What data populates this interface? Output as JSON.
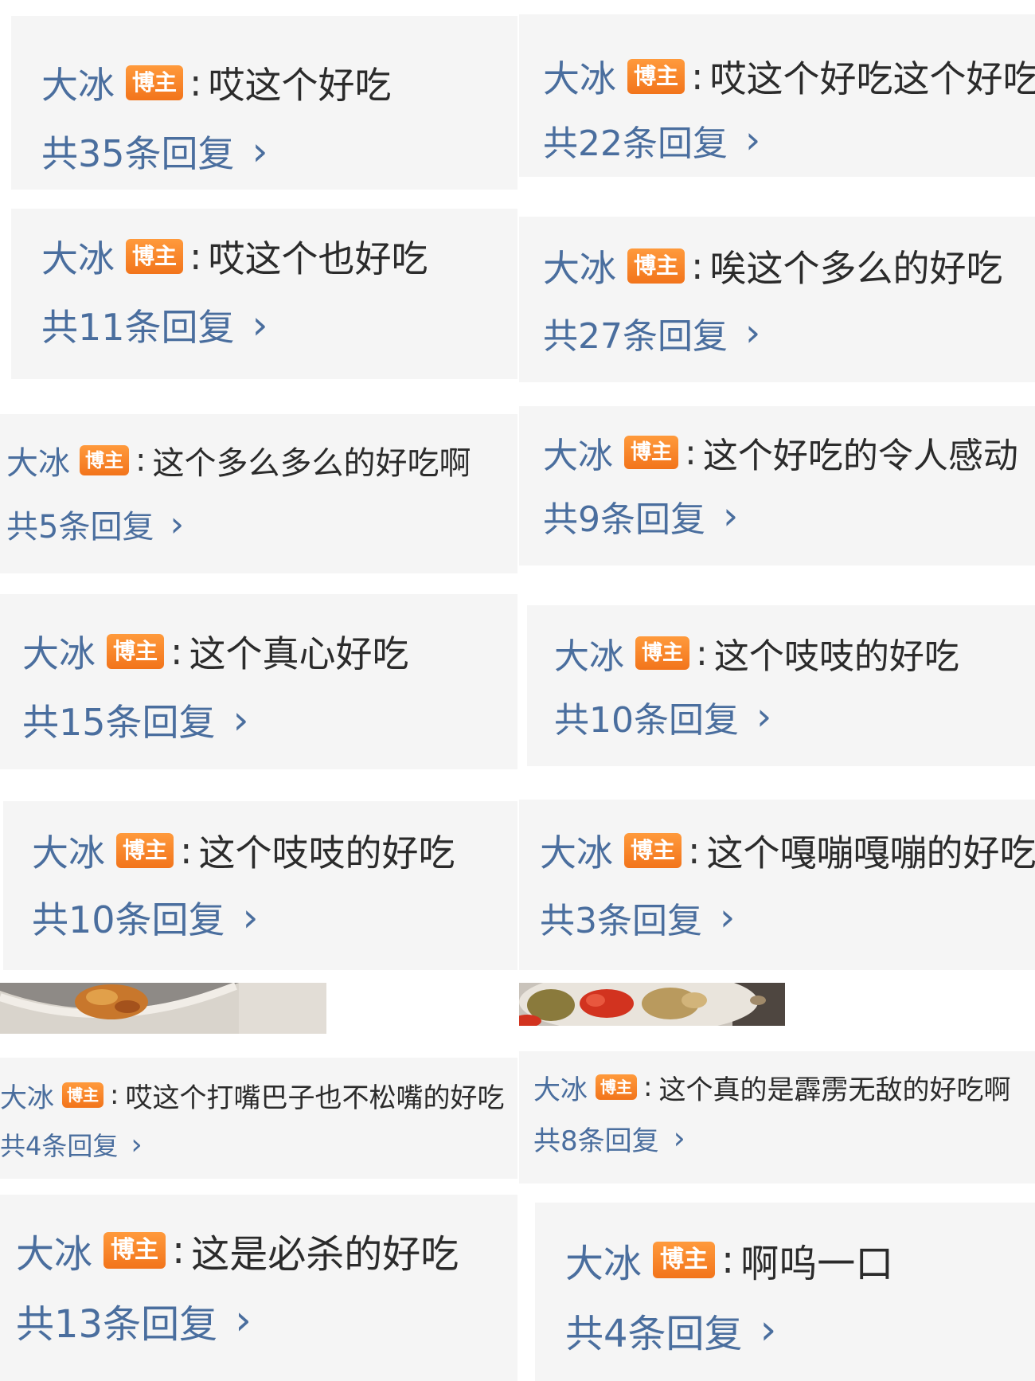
{
  "comments": [
    {
      "author": "大冰",
      "badge": "博主",
      "sep": ":",
      "text": "哎这个好吃",
      "replies": "共35条回复",
      "chevron": "›"
    },
    {
      "author": "大冰",
      "badge": "博主",
      "sep": ":",
      "text": "哎这个好吃这个好吃",
      "replies": "共22条回复",
      "chevron": "›"
    },
    {
      "author": "大冰",
      "badge": "博主",
      "sep": ":",
      "text": "哎这个也好吃",
      "replies": "共11条回复",
      "chevron": "›"
    },
    {
      "author": "大冰",
      "badge": "博主",
      "sep": ":",
      "text": "唉这个多么的好吃",
      "replies": "共27条回复",
      "chevron": "›"
    },
    {
      "author": "大冰",
      "badge": "博主",
      "sep": ":",
      "text": "这个多么多么的好吃啊",
      "replies": "共5条回复",
      "chevron": "›"
    },
    {
      "author": "大冰",
      "badge": "博主",
      "sep": ":",
      "text": "这个好吃的令人感动",
      "replies": "共9条回复",
      "chevron": "›"
    },
    {
      "author": "大冰",
      "badge": "博主",
      "sep": ":",
      "text": "这个真心好吃",
      "replies": "共15条回复",
      "chevron": "›"
    },
    {
      "author": "大冰",
      "badge": "博主",
      "sep": ":",
      "text": "这个吱吱的好吃",
      "replies": "共10条回复",
      "chevron": "›"
    },
    {
      "author": "大冰",
      "badge": "博主",
      "sep": ":",
      "text": "这个吱吱的好吃",
      "replies": "共10条回复",
      "chevron": "›"
    },
    {
      "author": "大冰",
      "badge": "博主",
      "sep": ":",
      "text": "这个嘎嘣嘎嘣的好吃",
      "replies": "共3条回复",
      "chevron": "›"
    },
    {
      "author": "大冰",
      "badge": "博主",
      "sep": ":",
      "text": "哎这个打嘴巴子也不松嘴的好吃",
      "replies": "共4条回复",
      "chevron": "›"
    },
    {
      "author": "大冰",
      "badge": "博主",
      "sep": ":",
      "text": "这个真的是霹雳无敌的好吃啊",
      "replies": "共8条回复",
      "chevron": "›"
    },
    {
      "author": "大冰",
      "badge": "博主",
      "sep": ":",
      "text": "这是必杀的好吃",
      "replies": "共13条回复",
      "chevron": "›"
    },
    {
      "author": "大冰",
      "badge": "博主",
      "sep": ":",
      "text": "啊呜一口",
      "replies": "共4条回复",
      "chevron": "›"
    }
  ],
  "colors": {
    "link_blue": "#4a6e9e",
    "badge_orange": "#f2741b",
    "card_bg": "#f5f5f5",
    "text_dark": "#2b2b2b"
  }
}
